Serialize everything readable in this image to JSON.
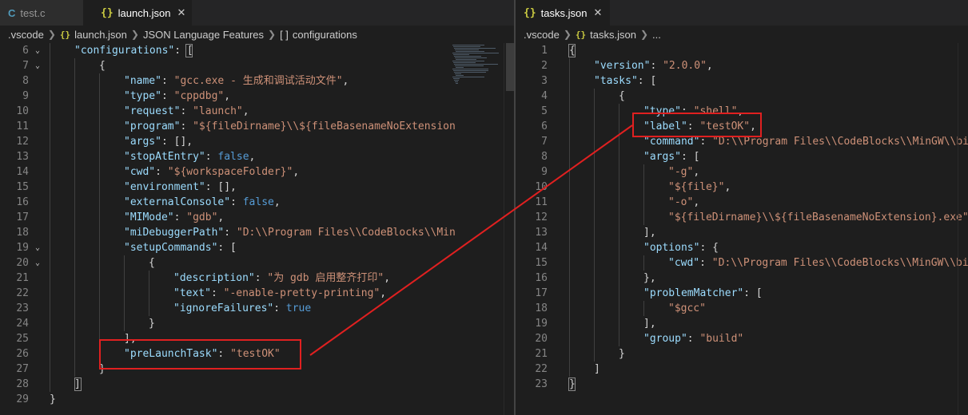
{
  "left": {
    "tabs": [
      {
        "icon": "C",
        "label": "test.c"
      },
      {
        "icon": "{}",
        "label": "launch.json",
        "close": "✕"
      }
    ],
    "breadcrumbs": [
      ".vscode",
      "launch.json",
      "JSON Language Features",
      "configurations"
    ],
    "breadcrumb_bracket_icon": "[ ]",
    "lines": [
      {
        "n": "6",
        "fold": "⌄",
        "indent": 1,
        "tokens": [
          [
            "k",
            "\"configurations\""
          ],
          [
            "p",
            ": "
          ],
          [
            "p",
            "["
          ]
        ]
      },
      {
        "n": "7",
        "fold": "⌄",
        "indent": 2,
        "tokens": [
          [
            "p",
            "{"
          ]
        ]
      },
      {
        "n": "8",
        "indent": 3,
        "tokens": [
          [
            "k",
            "\"name\""
          ],
          [
            "p",
            ": "
          ],
          [
            "s",
            "\"gcc.exe - 生成和调试活动文件\""
          ],
          [
            "p",
            ","
          ]
        ]
      },
      {
        "n": "9",
        "indent": 3,
        "tokens": [
          [
            "k",
            "\"type\""
          ],
          [
            "p",
            ": "
          ],
          [
            "s",
            "\"cppdbg\""
          ],
          [
            "p",
            ","
          ]
        ]
      },
      {
        "n": "10",
        "indent": 3,
        "tokens": [
          [
            "k",
            "\"request\""
          ],
          [
            "p",
            ": "
          ],
          [
            "s",
            "\"launch\""
          ],
          [
            "p",
            ","
          ]
        ]
      },
      {
        "n": "11",
        "indent": 3,
        "tokens": [
          [
            "k",
            "\"program\""
          ],
          [
            "p",
            ": "
          ],
          [
            "s",
            "\"${fileDirname}\\\\${fileBasenameNoExtension"
          ]
        ]
      },
      {
        "n": "12",
        "indent": 3,
        "tokens": [
          [
            "k",
            "\"args\""
          ],
          [
            "p",
            ": [],"
          ]
        ]
      },
      {
        "n": "13",
        "indent": 3,
        "tokens": [
          [
            "k",
            "\"stopAtEntry\""
          ],
          [
            "p",
            ": "
          ],
          [
            "b",
            "false"
          ],
          [
            "p",
            ","
          ]
        ]
      },
      {
        "n": "14",
        "indent": 3,
        "tokens": [
          [
            "k",
            "\"cwd\""
          ],
          [
            "p",
            ": "
          ],
          [
            "s",
            "\"${workspaceFolder}\""
          ],
          [
            "p",
            ","
          ]
        ]
      },
      {
        "n": "15",
        "indent": 3,
        "tokens": [
          [
            "k",
            "\"environment\""
          ],
          [
            "p",
            ": [],"
          ]
        ]
      },
      {
        "n": "16",
        "indent": 3,
        "tokens": [
          [
            "k",
            "\"externalConsole\""
          ],
          [
            "p",
            ": "
          ],
          [
            "b",
            "false"
          ],
          [
            "p",
            ","
          ]
        ]
      },
      {
        "n": "17",
        "indent": 3,
        "tokens": [
          [
            "k",
            "\"MIMode\""
          ],
          [
            "p",
            ": "
          ],
          [
            "s",
            "\"gdb\""
          ],
          [
            "p",
            ","
          ]
        ]
      },
      {
        "n": "18",
        "indent": 3,
        "tokens": [
          [
            "k",
            "\"miDebuggerPath\""
          ],
          [
            "p",
            ": "
          ],
          [
            "s",
            "\"D:\\\\Program Files\\\\CodeBlocks\\\\Min"
          ]
        ]
      },
      {
        "n": "19",
        "fold": "⌄",
        "indent": 3,
        "tokens": [
          [
            "k",
            "\"setupCommands\""
          ],
          [
            "p",
            ": ["
          ]
        ]
      },
      {
        "n": "20",
        "fold": "⌄",
        "indent": 4,
        "tokens": [
          [
            "p",
            "{"
          ]
        ]
      },
      {
        "n": "21",
        "indent": 5,
        "tokens": [
          [
            "k",
            "\"description\""
          ],
          [
            "p",
            ": "
          ],
          [
            "s",
            "\"为 gdb 启用整齐打印\""
          ],
          [
            "p",
            ","
          ]
        ]
      },
      {
        "n": "22",
        "indent": 5,
        "tokens": [
          [
            "k",
            "\"text\""
          ],
          [
            "p",
            ": "
          ],
          [
            "s",
            "\"-enable-pretty-printing\""
          ],
          [
            "p",
            ","
          ]
        ]
      },
      {
        "n": "23",
        "indent": 5,
        "tokens": [
          [
            "k",
            "\"ignoreFailures\""
          ],
          [
            "p",
            ": "
          ],
          [
            "b",
            "true"
          ]
        ]
      },
      {
        "n": "24",
        "indent": 4,
        "tokens": [
          [
            "p",
            "}"
          ]
        ]
      },
      {
        "n": "25",
        "indent": 3,
        "tokens": [
          [
            "p",
            "],"
          ]
        ]
      },
      {
        "n": "26",
        "indent": 3,
        "tokens": [
          [
            "k",
            "\"preLaunchTask\""
          ],
          [
            "p",
            ": "
          ],
          [
            "s",
            "\"testOK\""
          ]
        ]
      },
      {
        "n": "27",
        "indent": 2,
        "tokens": [
          [
            "p",
            "}"
          ]
        ]
      },
      {
        "n": "28",
        "indent": 1,
        "tokens": [
          [
            "p",
            "]"
          ]
        ]
      },
      {
        "n": "29",
        "indent": 0,
        "tokens": [
          [
            "p",
            "}"
          ]
        ]
      }
    ]
  },
  "right": {
    "tabs": [
      {
        "icon": "{}",
        "label": "tasks.json",
        "close": "✕"
      }
    ],
    "breadcrumbs": [
      ".vscode",
      "tasks.json",
      "..."
    ],
    "lines": [
      {
        "n": "1",
        "indent": 0,
        "tokens": [
          [
            "p",
            "{"
          ]
        ]
      },
      {
        "n": "2",
        "indent": 1,
        "tokens": [
          [
            "k",
            "\"version\""
          ],
          [
            "p",
            ": "
          ],
          [
            "s",
            "\"2.0.0\""
          ],
          [
            "p",
            ","
          ]
        ]
      },
      {
        "n": "3",
        "indent": 1,
        "tokens": [
          [
            "k",
            "\"tasks\""
          ],
          [
            "p",
            ": ["
          ]
        ]
      },
      {
        "n": "4",
        "indent": 2,
        "tokens": [
          [
            "p",
            "{"
          ]
        ]
      },
      {
        "n": "5",
        "indent": 3,
        "tokens": [
          [
            "k",
            "\"type\""
          ],
          [
            "p",
            ": "
          ],
          [
            "s",
            "\"shell\""
          ],
          [
            "p",
            ","
          ]
        ]
      },
      {
        "n": "6",
        "indent": 3,
        "tokens": [
          [
            "k",
            "\"label\""
          ],
          [
            "p",
            ": "
          ],
          [
            "s",
            "\"testOK\""
          ],
          [
            "p",
            ","
          ]
        ]
      },
      {
        "n": "7",
        "indent": 3,
        "tokens": [
          [
            "k",
            "\"command\""
          ],
          [
            "p",
            ": "
          ],
          [
            "s",
            "\"D:\\\\Program Files\\\\CodeBlocks\\\\MinGW\\\\bi"
          ]
        ]
      },
      {
        "n": "8",
        "indent": 3,
        "tokens": [
          [
            "k",
            "\"args\""
          ],
          [
            "p",
            ": ["
          ]
        ]
      },
      {
        "n": "9",
        "indent": 4,
        "tokens": [
          [
            "s",
            "\"-g\""
          ],
          [
            "p",
            ","
          ]
        ]
      },
      {
        "n": "10",
        "indent": 4,
        "tokens": [
          [
            "s",
            "\"${file}\""
          ],
          [
            "p",
            ","
          ]
        ]
      },
      {
        "n": "11",
        "indent": 4,
        "tokens": [
          [
            "s",
            "\"-o\""
          ],
          [
            "p",
            ","
          ]
        ]
      },
      {
        "n": "12",
        "indent": 4,
        "tokens": [
          [
            "s",
            "\"${fileDirname}\\\\${fileBasenameNoExtension}.exe\""
          ]
        ]
      },
      {
        "n": "13",
        "indent": 3,
        "tokens": [
          [
            "p",
            "],"
          ]
        ]
      },
      {
        "n": "14",
        "indent": 3,
        "tokens": [
          [
            "k",
            "\"options\""
          ],
          [
            "p",
            ": {"
          ]
        ]
      },
      {
        "n": "15",
        "indent": 4,
        "tokens": [
          [
            "k",
            "\"cwd\""
          ],
          [
            "p",
            ": "
          ],
          [
            "s",
            "\"D:\\\\Program Files\\\\CodeBlocks\\\\MinGW\\\\bi"
          ]
        ]
      },
      {
        "n": "16",
        "indent": 3,
        "tokens": [
          [
            "p",
            "},"
          ]
        ]
      },
      {
        "n": "17",
        "indent": 3,
        "tokens": [
          [
            "k",
            "\"problemMatcher\""
          ],
          [
            "p",
            ": ["
          ]
        ]
      },
      {
        "n": "18",
        "indent": 4,
        "tokens": [
          [
            "s",
            "\"$gcc\""
          ]
        ]
      },
      {
        "n": "19",
        "indent": 3,
        "tokens": [
          [
            "p",
            "],"
          ]
        ]
      },
      {
        "n": "20",
        "indent": 3,
        "tokens": [
          [
            "k",
            "\"group\""
          ],
          [
            "p",
            ": "
          ],
          [
            "s",
            "\"build\""
          ]
        ]
      },
      {
        "n": "21",
        "indent": 2,
        "tokens": [
          [
            "p",
            "}"
          ]
        ]
      },
      {
        "n": "22",
        "indent": 1,
        "tokens": [
          [
            "p",
            "]"
          ]
        ]
      },
      {
        "n": "23",
        "indent": 0,
        "tokens": [
          [
            "p",
            "}"
          ]
        ]
      }
    ]
  },
  "colors": {
    "annotation": "#e02020",
    "key": "#9cdcfe",
    "string": "#ce9178",
    "keyword": "#569cd6",
    "json_icon": "#cbcb41",
    "c_icon": "#519aba"
  }
}
